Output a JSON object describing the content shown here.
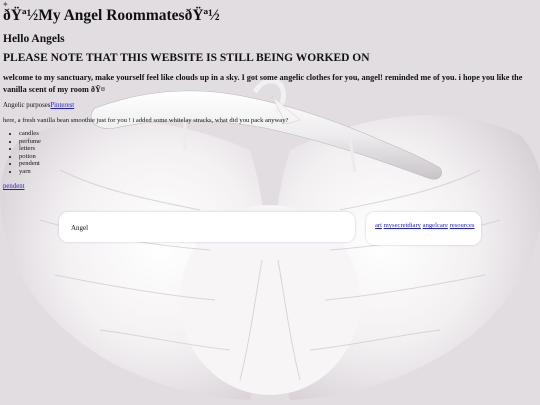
{
  "sparkle": "✦",
  "title": "ðŸª½My Angel RoommatesðŸª½",
  "greeting": "Hello Angels",
  "notice": "PLEASE NOTE THAT THIS WEBSITE IS STILL BEING WORKED ON",
  "welcome": "welcome to my sanctuary, make yourself feel like clouds up in a sky. I got some angelic clothes for you, angel! reminded me of you. i hope you like the vanilla scent of my room ðŸ¤",
  "purposes": {
    "label": "Angelic purposes",
    "link": "Pinterest"
  },
  "smoothie": "here, a fresh vanilla bean smoothie just for you ! i added some whitelay stracks, what did you pack anyway?",
  "items": [
    "candles",
    "perfume",
    "letters",
    "potion",
    "pendent",
    "yarn"
  ],
  "pendent_link": "pendent",
  "main_panel": {
    "text": "Angel"
  },
  "side_panel": {
    "links": [
      "art",
      "mysecretdiary",
      "angelcare",
      "resources"
    ]
  },
  "colors": {
    "background": "#e4dfe2",
    "link": "#1d1dd6"
  }
}
